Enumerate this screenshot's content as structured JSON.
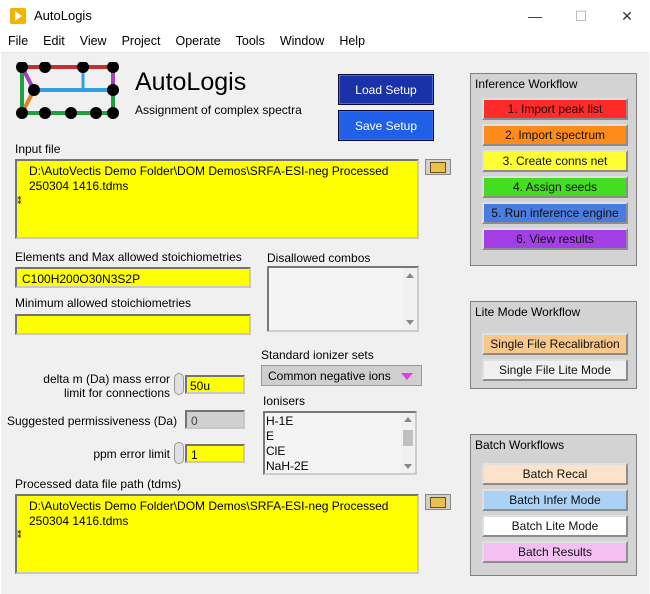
{
  "window": {
    "title": "AutoLogis",
    "minimize": "—",
    "maximize": "☐",
    "close": "✕"
  },
  "menu": [
    "File",
    "Edit",
    "View",
    "Project",
    "Operate",
    "Tools",
    "Window",
    "Help"
  ],
  "header": {
    "title": "AutoLogis",
    "subtitle": "Assignment of complex spectra"
  },
  "buttons": {
    "load_setup": "Load Setup",
    "save_setup": "Save Setup"
  },
  "input_file": {
    "label": "Input file",
    "value": "D:\\AutoVectis Demo Folder\\DOM Demos\\SRFA-ESI-neg Processed 250304 1416.tdms"
  },
  "elements": {
    "label": "Elements and Max allowed stoichiometries",
    "value": "C100H200O30N3S2P"
  },
  "disallowed": {
    "label": "Disallowed combos"
  },
  "min_stoich": {
    "label": "Minimum allowed stoichiometries",
    "value": ""
  },
  "delta_m": {
    "label_line1": "delta m (Da) mass error",
    "label_line2": "limit for connections",
    "value": "50u"
  },
  "permissiveness": {
    "label": "Suggested permissiveness (Da)",
    "value": "0"
  },
  "ppm": {
    "label": "ppm error limit",
    "value": "1"
  },
  "ionizer_sets": {
    "label": "Standard ionizer sets",
    "selected": "Common negative ions"
  },
  "ionisers": {
    "label": "Ionisers",
    "items": [
      "H-1E",
      "E",
      "ClE",
      "NaH-2E"
    ]
  },
  "processed": {
    "label": "Processed data file path (tdms)",
    "value": "D:\\AutoVectis Demo Folder\\DOM Demos\\SRFA-ESI-neg Processed 250304 1416.tdms"
  },
  "inference": {
    "title": "Inference Workflow",
    "steps": [
      {
        "label": "1. Import peak list",
        "color": "#ff2a2a"
      },
      {
        "label": "2. Import spectrum",
        "color": "#ff8c1a"
      },
      {
        "label": "3. Create conns net",
        "color": "#ffff33"
      },
      {
        "label": "4. Assign seeds",
        "color": "#44dd22"
      },
      {
        "label": "5. Run inference engine",
        "color": "#4a7de0"
      },
      {
        "label": "6. View results",
        "color": "#a43ee6"
      }
    ]
  },
  "lite": {
    "title": "Lite Mode Workflow",
    "buttons": [
      {
        "label": "Single File Recalibration",
        "color": "#f7c88a"
      },
      {
        "label": "Single File Lite Mode",
        "color": "#f0f0f0"
      }
    ]
  },
  "batch": {
    "title": "Batch Workflows",
    "buttons": [
      {
        "label": "Batch Recal",
        "color": "#fbe2c8"
      },
      {
        "label": "Batch Infer Mode",
        "color": "#a9d2f5"
      },
      {
        "label": "Batch Lite Mode",
        "color": "#ffffff"
      },
      {
        "label": "Batch Results",
        "color": "#f4c0f4"
      }
    ]
  }
}
